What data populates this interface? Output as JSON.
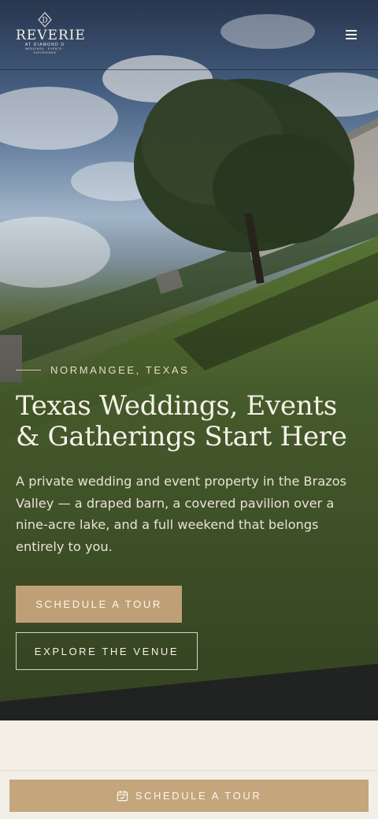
{
  "brand": {
    "name": "REVERIE",
    "sub": "AT DIAMOND D",
    "tagline": "WEDDINGS · EVENTS · GATHERINGS",
    "location_tag": "NORMANGEE, TEXAS"
  },
  "icons": {
    "menu": "hamburger-menu-icon",
    "calendar": "calendar-check-icon",
    "logo": "diamond-d-logo"
  },
  "hero": {
    "eyebrow": "NORMANGEE, TEXAS",
    "title": "Texas Weddings, Events & Gatherings Start Here",
    "lede": "A private wedding and event property in the Brazos Valley — a draped barn, a covered pavilion over a nine-acre lake, and a full weekend that belongs entirely to you.",
    "primary_cta": "SCHEDULE A TOUR",
    "secondary_cta": "EXPLORE THE VENUE"
  },
  "sticky": {
    "cta": "SCHEDULE A TOUR"
  },
  "colors": {
    "accent": "#bf9f76",
    "cream": "#f3efe7",
    "text_light": "#f6f1e8"
  }
}
